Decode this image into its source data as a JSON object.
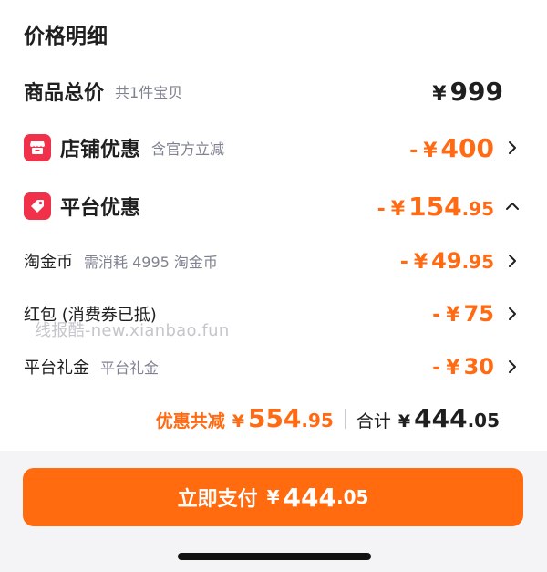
{
  "header": {
    "title": "价格明细"
  },
  "rows": {
    "total": {
      "label": "商品总价",
      "note": "共1件宝贝",
      "yen": "¥",
      "int": "999",
      "dec": ""
    },
    "store": {
      "label": "店铺优惠",
      "note": "含官方立减",
      "minus": "-",
      "yen": "¥",
      "int": "400",
      "dec": "",
      "icon": "store-icon"
    },
    "platform": {
      "label": "平台优惠",
      "note": "",
      "minus": "-",
      "yen": "¥",
      "int": "154",
      "dec": ".95",
      "icon": "tag-icon"
    },
    "coins": {
      "label": "淘金币",
      "note": "需消耗 4995 淘金币",
      "minus": "-",
      "yen": "¥",
      "int": "49",
      "dec": ".95"
    },
    "redpacket": {
      "label": "红包 (消费券已抵)",
      "note": "",
      "minus": "-",
      "yen": "¥",
      "int": "75",
      "dec": ""
    },
    "gift": {
      "label": "平台礼金",
      "note": "平台礼金",
      "minus": "-",
      "yen": "¥",
      "int": "30",
      "dec": ""
    }
  },
  "summary": {
    "discount_label": "优惠共减",
    "discount_yen": "¥",
    "discount_int": "554",
    "discount_dec": ".95",
    "total_label": "合计",
    "total_yen": "¥",
    "total_int": "444",
    "total_dec": ".05"
  },
  "watermark": "线报酷-new.xianbao.fun",
  "pay_button": {
    "label": "立即支付",
    "yen": "¥",
    "int": "444",
    "dec": ".05"
  },
  "colors": {
    "accent": "#ff6a12",
    "badge": "#f1304a",
    "button": "#ff6b0e"
  }
}
